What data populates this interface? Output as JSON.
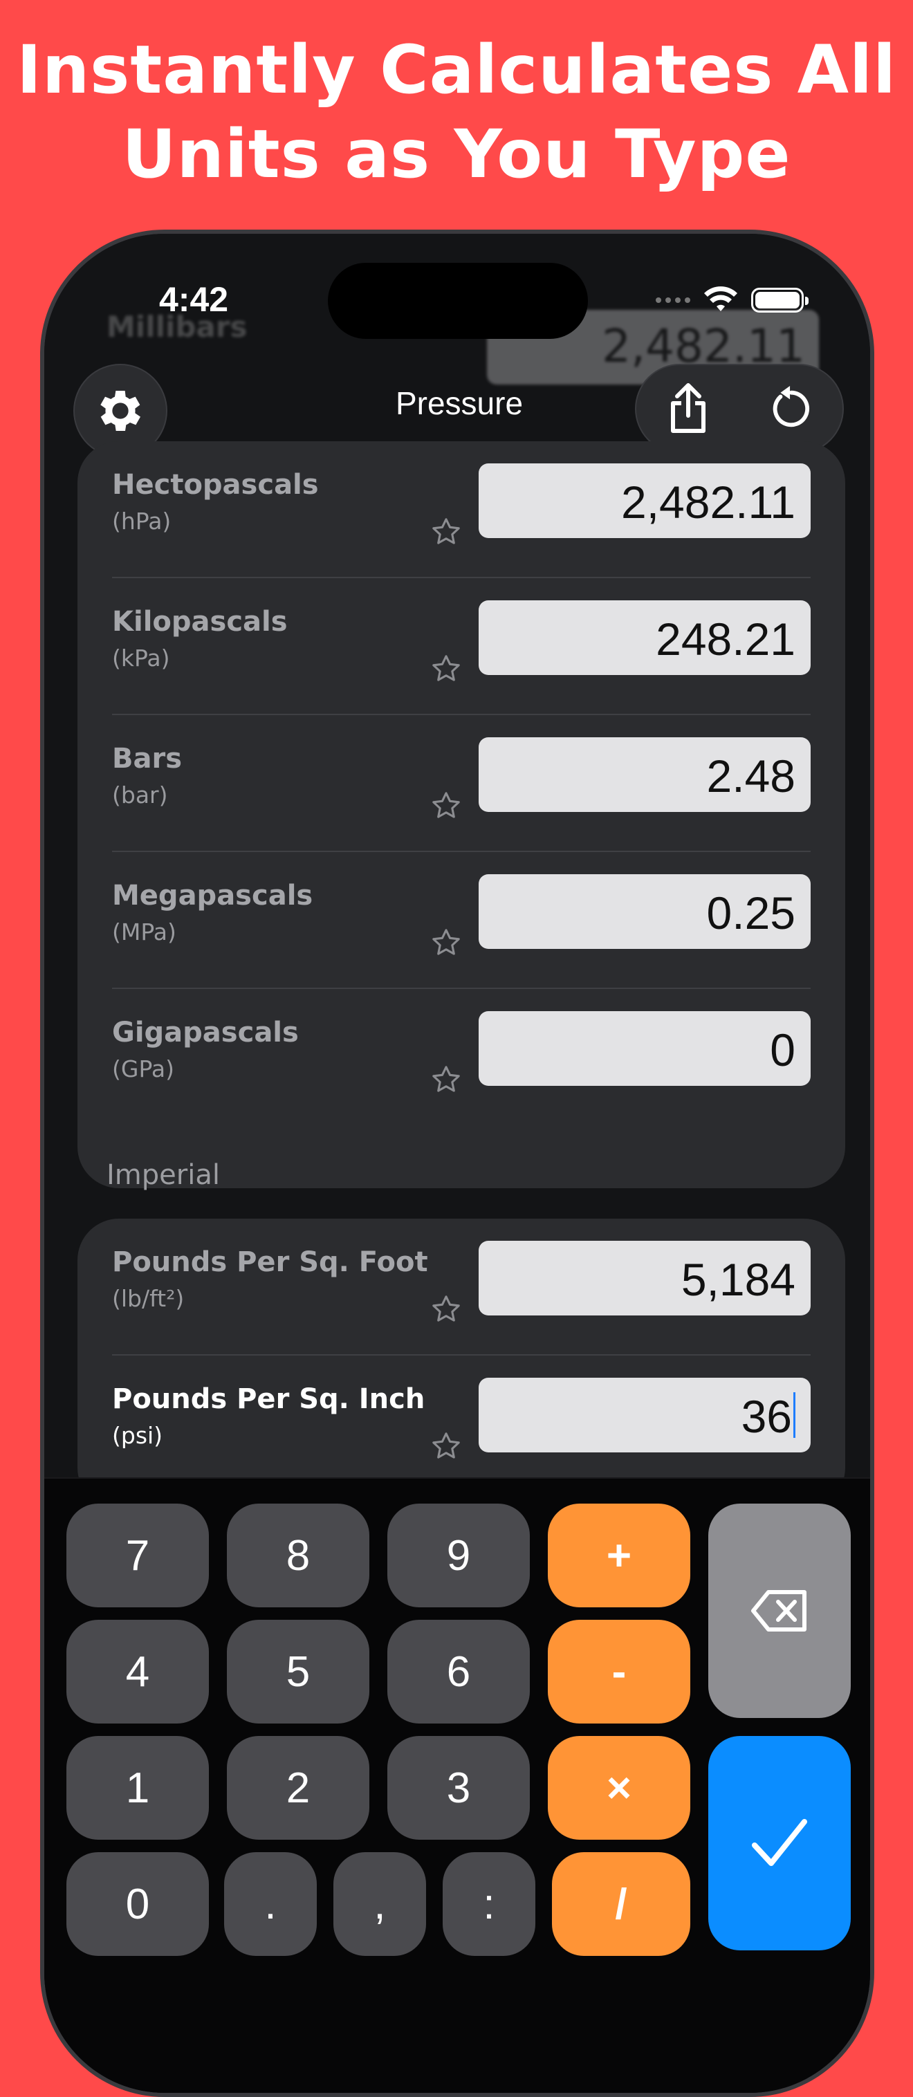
{
  "headline": {
    "line1": "Instantly Calculates All",
    "line2": "Units as You Type"
  },
  "status_bar": {
    "time": "4:42"
  },
  "nav": {
    "title": "Pressure"
  },
  "ghost_rows": [
    {
      "name": "Millibars",
      "value": "2,482.11"
    }
  ],
  "metric_units": [
    {
      "name": "Hectopascals",
      "abbr": "(hPa)",
      "value": "2,482.11"
    },
    {
      "name": "Kilopascals",
      "abbr": "(kPa)",
      "value": "248.21"
    },
    {
      "name": "Bars",
      "abbr": "(bar)",
      "value": "2.48"
    },
    {
      "name": "Megapascals",
      "abbr": "(MPa)",
      "value": "0.25"
    },
    {
      "name": "Gigapascals",
      "abbr": "(GPa)",
      "value": "0"
    }
  ],
  "imperial": {
    "section_label": "Imperial",
    "units": [
      {
        "name": "Pounds Per Sq. Foot",
        "abbr": "(lb/ft²)",
        "value": "5,184"
      },
      {
        "name": "Pounds Per Sq. Inch",
        "abbr": "(psi)",
        "value": "36"
      }
    ]
  },
  "keypad": {
    "k7": "7",
    "k8": "8",
    "k9": "9",
    "plus": "+",
    "k4": "4",
    "k5": "5",
    "k6": "6",
    "minus": "-",
    "k1": "1",
    "k2": "2",
    "k3": "3",
    "times": "×",
    "k0": "0",
    "dot": ".",
    "comma": ",",
    "colon": ":",
    "divide": "/"
  },
  "colors": {
    "background": "#ff4a4a",
    "operator_key": "#ff9436",
    "confirm_key": "#0b8dff"
  }
}
